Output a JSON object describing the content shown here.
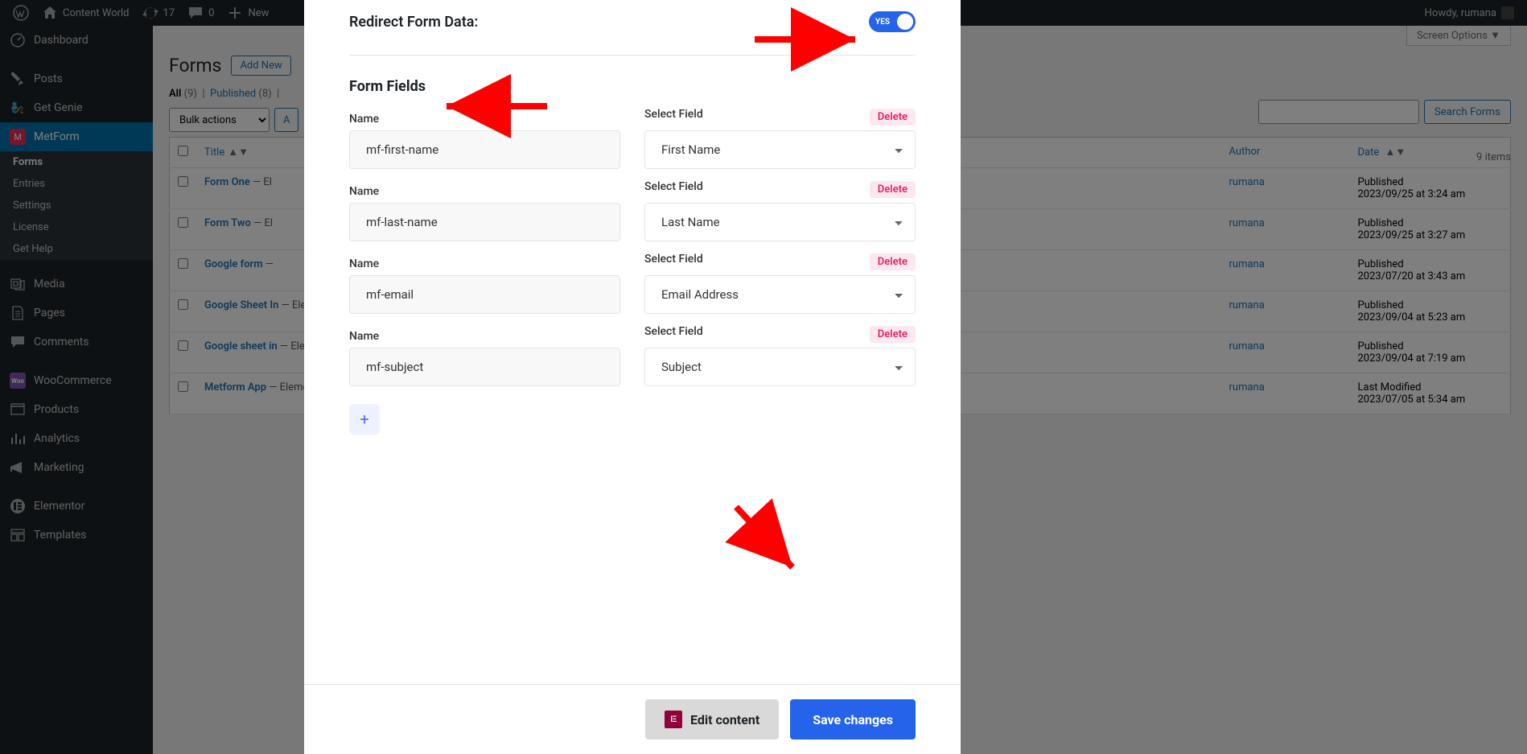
{
  "adminbar": {
    "site_name": "Content World",
    "updates": "17",
    "comments": "0",
    "new": "New",
    "howdy": "Howdy, rumana"
  },
  "sidebar": {
    "items": [
      {
        "label": "Dashboard",
        "icon": "dashboard"
      },
      {
        "label": "Posts",
        "icon": "pin"
      },
      {
        "label": "Get Genie",
        "icon": "genie"
      },
      {
        "label": "MetForm",
        "icon": "metform",
        "active": true
      },
      {
        "label": "Media",
        "icon": "media"
      },
      {
        "label": "Pages",
        "icon": "page"
      },
      {
        "label": "Comments",
        "icon": "comment"
      },
      {
        "label": "WooCommerce",
        "icon": "woo"
      },
      {
        "label": "Products",
        "icon": "products"
      },
      {
        "label": "Analytics",
        "icon": "analytics"
      },
      {
        "label": "Marketing",
        "icon": "marketing"
      },
      {
        "label": "Elementor",
        "icon": "elementor"
      },
      {
        "label": "Templates",
        "icon": "templates"
      }
    ],
    "submenu": [
      "Forms",
      "Entries",
      "Settings",
      "License",
      "Get Help"
    ]
  },
  "page": {
    "title": "Forms",
    "add_new": "Add New",
    "filters": {
      "all": "All",
      "all_count": "(9)",
      "published": "Published",
      "published_count": "(8)"
    },
    "bulk_label": "Bulk actions",
    "apply": "A",
    "search_btn": "Search Forms",
    "items_count": "9 items",
    "screen_options": "Screen Options ▼"
  },
  "table": {
    "cols": {
      "title": "Title",
      "author": "Author",
      "date": "Date"
    },
    "rows": [
      {
        "title": "Form One",
        "builder": "El",
        "author": "rumana",
        "date_status": "Published",
        "date": "2023/09/25 at 3:24 am"
      },
      {
        "title": "Form Two",
        "builder": "El",
        "author": "rumana",
        "date_status": "Published",
        "date": "2023/09/25 at 3:27 am"
      },
      {
        "title": "Google form",
        "builder": "",
        "author": "rumana",
        "date_status": "Published",
        "date": "2023/07/20 at 3:43 am"
      },
      {
        "title": "Google Sheet In",
        "builder": "Elementor",
        "author": "rumana",
        "date_status": "Published",
        "date": "2023/09/04 at 5:23 am"
      },
      {
        "title": "Google sheet in",
        "builder": "Elementor",
        "author": "rumana",
        "date_status": "Published",
        "date": "2023/09/04 at 7:19 am"
      },
      {
        "title": "Metform App",
        "builder": "Elementor",
        "author": "rumana",
        "date_status": "Last Modified",
        "date": "2023/07/05 at 5:34 am"
      }
    ]
  },
  "modal": {
    "redirect_label": "Redirect Form Data:",
    "toggle_state": "YES",
    "section_title": "Form Fields",
    "name_label": "Name",
    "select_label": "Select Field",
    "delete_label": "Delete",
    "fields": [
      {
        "name": "mf-first-name",
        "select": "First Name"
      },
      {
        "name": "mf-last-name",
        "select": "Last Name"
      },
      {
        "name": "mf-email",
        "select": "Email Address"
      },
      {
        "name": "mf-subject",
        "select": "Subject"
      }
    ],
    "add_btn": "+",
    "edit_content": "Edit content",
    "save_changes": "Save changes"
  }
}
